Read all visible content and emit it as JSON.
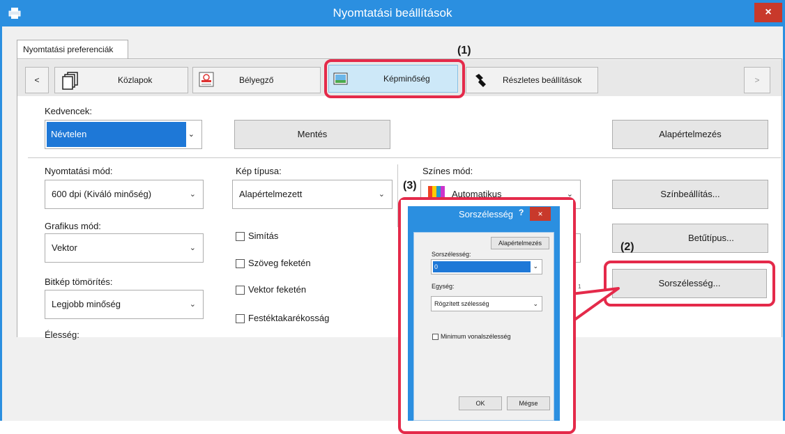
{
  "window": {
    "title": "Nyomtatási beállítások",
    "close_glyph": "×"
  },
  "tab": {
    "label": "Nyomtatási preferenciák"
  },
  "nav": {
    "prev": "<",
    "next": ">",
    "items": [
      {
        "label": "Közlapok",
        "icon": "copies-icon"
      },
      {
        "label": "Bélyegző",
        "icon": "stamp-icon"
      },
      {
        "label": "Képminőség",
        "icon": "image-quality-icon"
      },
      {
        "label": "Részletes beállítások",
        "icon": "wrench-icon"
      }
    ]
  },
  "favorites": {
    "label": "Kedvencek:",
    "value": "Névtelen",
    "save": "Mentés",
    "defaults": "Alapértelmezés"
  },
  "print_mode": {
    "label": "Nyomtatási mód:",
    "value": "600 dpi (Kiváló minőség)"
  },
  "image_type": {
    "label": "Kép típusa:",
    "value": "Alapértelmezett"
  },
  "color_mode": {
    "label": "Színes mód:",
    "value": "Automatikus"
  },
  "graphics_mode": {
    "label": "Grafikus mód:",
    "value": "Vektor"
  },
  "bitmap": {
    "label": "Bitkép tömörítés:",
    "value": "Legjobb minőség"
  },
  "sharpness": {
    "label": "Élesség:"
  },
  "checkboxes": [
    "Simítás",
    "Szöveg feketén",
    "Vektor feketén",
    "Festéktakarékosság"
  ],
  "right_buttons": {
    "color_settings": "Színbeállítás...",
    "font": "Betűtípus...",
    "line_width": "Sorszélesség..."
  },
  "callouts": {
    "one": "(1)",
    "two": "(2)",
    "three": "(3)"
  },
  "dialog": {
    "title": "Sorszélesség",
    "help": "?",
    "close": "×",
    "defaults": "Alapértelmezés",
    "width_label": "Sorszélesség:",
    "width_value": "0",
    "unit_label": "Egység:",
    "unit_value": "Rögzített szélesség",
    "min_width": "Minimum vonalszélesség",
    "ok": "OK",
    "cancel": "Mégse"
  },
  "colors": {
    "titlebar": "#2b8fe0",
    "close": "#c8392b",
    "highlight": "#e42a4a",
    "selected": "#1e78d7"
  }
}
